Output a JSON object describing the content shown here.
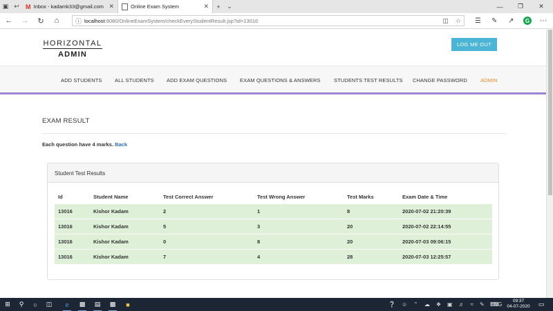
{
  "browser": {
    "tabs": [
      {
        "title": "Inbox - kadamk33@gmail.com",
        "icon": "gmail-icon"
      },
      {
        "title": "Online Exam System",
        "icon": "page-icon"
      }
    ],
    "url_host": "localhost",
    "url_path": ":8080/OnlineExamSystem/checkEveryStudentResult.jsp?id=13016"
  },
  "header": {
    "logo_line1": "HORIZONTAL",
    "logo_line2": "ADMIN",
    "logout_label": "LOG ME OUT"
  },
  "nav": {
    "items": [
      "ADD STUDENTS",
      "ALL STUDENTS",
      "ADD EXAM QUESTIONS",
      "EXAM QUESTIONS & ANSWERS",
      "STUDENTS TEST RESULTS",
      "CHANGE PASSWORD",
      "ADMIN"
    ]
  },
  "main": {
    "title": "EXAM RESULT",
    "note": "Each question have 4 marks.",
    "back_label": "Back",
    "panel_title": "Student Test Results",
    "columns": [
      "Id",
      "Student Name",
      "Test Correct Answer",
      "Test Wrong Answer",
      "Test Marks",
      "Exam Date & Time"
    ],
    "rows": [
      [
        "13016",
        "Kishor Kadam",
        "2",
        "1",
        "8",
        "2020-07-02 21:20:39"
      ],
      [
        "13016",
        "Kishor Kadam",
        "5",
        "3",
        "20",
        "2020-07-02 22:14:55"
      ],
      [
        "13016",
        "Kishor Kadam",
        "0",
        "8",
        "20",
        "2020-07-03 09:06:15"
      ],
      [
        "13016",
        "Kishor Kadam",
        "7",
        "4",
        "28",
        "2020-07-03 12:25:57"
      ]
    ]
  },
  "taskbar": {
    "language": "ENG",
    "time": "09:37",
    "date": "04-07-2020"
  },
  "colors": {
    "accent_nav": "#9b85d2",
    "active_nav": "#f08a2b",
    "button": "#4cb4d4",
    "row_bg": "#dff0d8",
    "link": "#2a6fb4"
  }
}
